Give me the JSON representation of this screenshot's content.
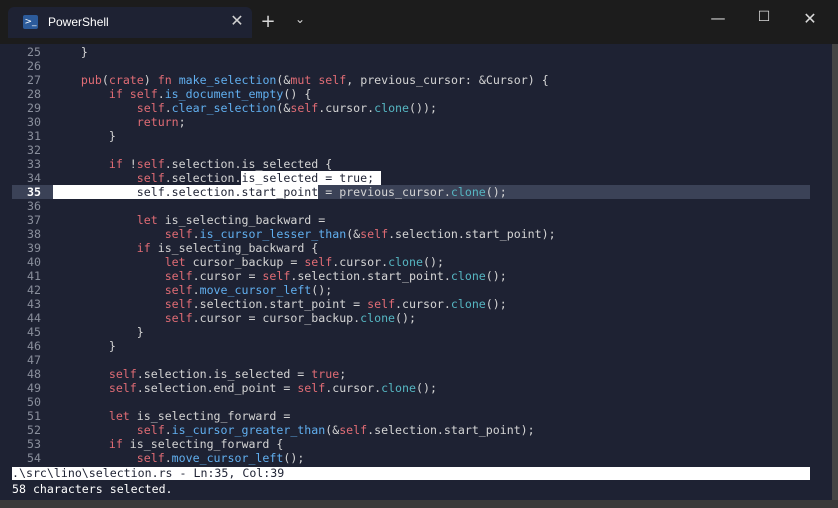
{
  "window": {
    "tab_title": "PowerShell",
    "tab_icon": "powershell-icon",
    "tab_close": "✕",
    "new_tab": "+",
    "dropdown": "⌄",
    "minimize": "—",
    "maximize": "☐",
    "close": "✕"
  },
  "editor": {
    "current_line": "35",
    "lines": [
      {
        "n": "25",
        "t": "    }"
      },
      {
        "n": "26",
        "t": ""
      },
      {
        "n": "27",
        "t": "    pub(crate) fn make_selection(&mut self, previous_cursor: &Cursor) {"
      },
      {
        "n": "28",
        "t": "        if self.is_document_empty() {"
      },
      {
        "n": "29",
        "t": "            self.clear_selection(&self.cursor.clone());"
      },
      {
        "n": "30",
        "t": "            return;"
      },
      {
        "n": "31",
        "t": "        }"
      },
      {
        "n": "32",
        "t": ""
      },
      {
        "n": "33",
        "t": "        if !self.selection.is_selected {"
      },
      {
        "n": "34",
        "t": "            self.selection.is_selected = true;"
      },
      {
        "n": "35",
        "t": "            self.selection.start_point = previous_cursor.clone();"
      },
      {
        "n": "36",
        "t": ""
      },
      {
        "n": "37",
        "t": "            let is_selecting_backward ="
      },
      {
        "n": "38",
        "t": "                self.is_cursor_lesser_than(&self.selection.start_point);"
      },
      {
        "n": "39",
        "t": "            if is_selecting_backward {"
      },
      {
        "n": "40",
        "t": "                let cursor_backup = self.cursor.clone();"
      },
      {
        "n": "41",
        "t": "                self.cursor = self.selection.start_point.clone();"
      },
      {
        "n": "42",
        "t": "                self.move_cursor_left();"
      },
      {
        "n": "43",
        "t": "                self.selection.start_point = self.cursor.clone();"
      },
      {
        "n": "44",
        "t": "                self.cursor = cursor_backup.clone();"
      },
      {
        "n": "45",
        "t": "            }"
      },
      {
        "n": "46",
        "t": "        }"
      },
      {
        "n": "47",
        "t": ""
      },
      {
        "n": "48",
        "t": "        self.selection.is_selected = true;"
      },
      {
        "n": "49",
        "t": "        self.selection.end_point = self.cursor.clone();"
      },
      {
        "n": "50",
        "t": ""
      },
      {
        "n": "51",
        "t": "        let is_selecting_forward ="
      },
      {
        "n": "52",
        "t": "            self.is_cursor_greater_than(&self.selection.start_point);"
      },
      {
        "n": "53",
        "t": "        if is_selecting_forward {"
      },
      {
        "n": "54",
        "t": "            self.move_cursor_left();"
      }
    ]
  },
  "status": {
    "file_info": ".\\src\\lino\\selection.rs - Ln:35, Col:39",
    "message": "58 characters selected."
  },
  "colors": {
    "background": "#1e2233",
    "keyword": "#e06c75",
    "function": "#61afef",
    "clone": "#56b6c2",
    "selection": "#ffffff"
  }
}
